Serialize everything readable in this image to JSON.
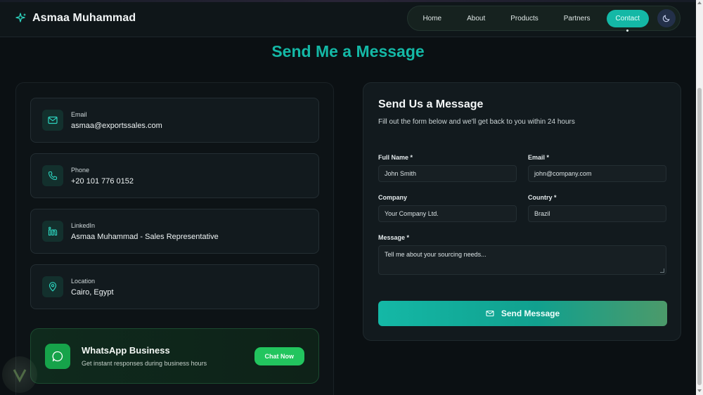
{
  "header": {
    "brand": "Asmaa Muhammad",
    "nav": [
      "Home",
      "About",
      "Products",
      "Partners",
      "Contact"
    ],
    "active_nav": "Contact"
  },
  "page_title": "Send Me a Message",
  "contact_info": [
    {
      "icon": "mail-icon",
      "label": "Email",
      "value": "asmaa@exportssales.com"
    },
    {
      "icon": "phone-icon",
      "label": "Phone",
      "value": "+20 101 776 0152"
    },
    {
      "icon": "linkedin-icon",
      "label": "LinkedIn",
      "value": "Asmaa Muhammad - Sales Representative"
    },
    {
      "icon": "location-pin-icon",
      "label": "Location",
      "value": "Cairo, Egypt"
    }
  ],
  "whatsapp": {
    "title": "WhatsApp Business",
    "subtitle": "Get instant responses during business hours",
    "button": "Chat Now"
  },
  "form": {
    "title": "Send Us a Message",
    "subtitle": "Fill out the form below and we'll get back to you within 24 hours",
    "full_name_label": "Full Name *",
    "full_name_value": "John Smith",
    "email_label": "Email *",
    "email_value": "john@company.com",
    "company_label": "Company",
    "company_value": "Your Company Ltd.",
    "country_label": "Country *",
    "country_value": "Brazil",
    "message_label": "Message *",
    "message_placeholder": "Tell me about your sourcing needs...",
    "submit_label": "Send Message"
  },
  "colors": {
    "accent": "#14b8a6",
    "whatsapp": "#22c55e",
    "background": "#0b1013"
  }
}
